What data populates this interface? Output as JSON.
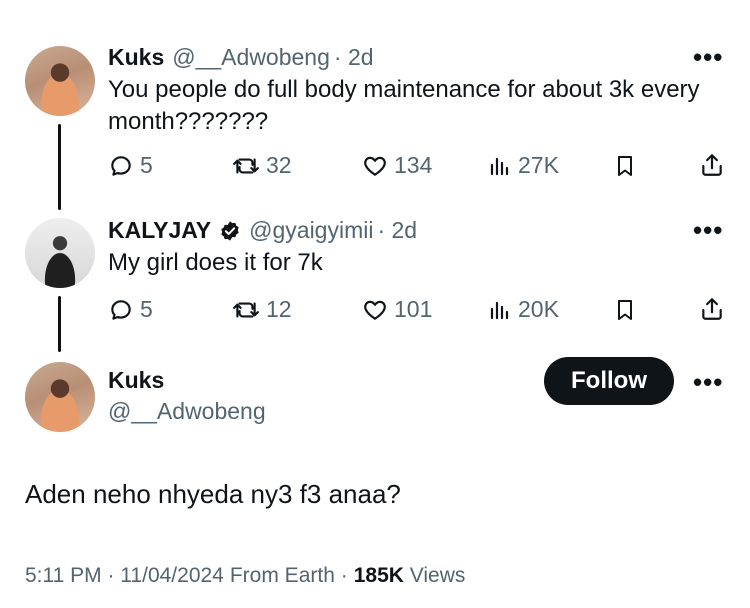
{
  "tweets": [
    {
      "name": "Kuks",
      "handle": "@__Adwobeng",
      "time": "· 2d",
      "verified": false,
      "text_line1": "You people do full body maintenance for about 3k every",
      "text_line2": "month???????",
      "replies": "5",
      "retweets": "32",
      "likes": "134",
      "views": "27K"
    },
    {
      "name": "KALYJAY",
      "handle": "@gyaigyimii",
      "time": "· 2d",
      "verified": true,
      "text_line1": "My girl does it for 7k",
      "replies": "5",
      "retweets": "12",
      "likes": "101",
      "views": "20K"
    }
  ],
  "main": {
    "name": "Kuks",
    "handle": "@__Adwobeng",
    "follow_label": "Follow",
    "text": "Aden neho nhyeda ny3 f3 anaa?",
    "footer_time": "5:11 PM · 11/04/2024",
    "footer_source": "From Earth ·",
    "footer_views_count": "185K",
    "footer_views_label": "Views"
  },
  "colors": {
    "text": "#0f1419",
    "secondary": "#536471",
    "follow_bg": "#0f1419"
  },
  "icons": [
    "reply-icon",
    "retweet-icon",
    "like-icon",
    "views-icon",
    "bookmark-icon",
    "share-icon",
    "more-icon",
    "verified-icon"
  ]
}
